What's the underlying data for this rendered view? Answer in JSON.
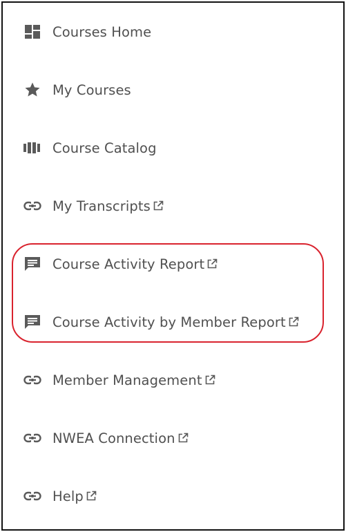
{
  "nav": {
    "items": [
      {
        "label": "Courses Home",
        "icon": "dashboard-icon",
        "external": false
      },
      {
        "label": "My Courses",
        "icon": "star-icon",
        "external": false
      },
      {
        "label": "Course Catalog",
        "icon": "catalog-icon",
        "external": false
      },
      {
        "label": "My Transcripts",
        "icon": "link-icon",
        "external": true
      },
      {
        "label": "Course Activity Report",
        "icon": "report-icon",
        "external": true
      },
      {
        "label": "Course Activity by Member Report",
        "icon": "report-icon",
        "external": true
      },
      {
        "label": "Member Management",
        "icon": "link-icon",
        "external": true
      },
      {
        "label": "NWEA Connection",
        "icon": "link-icon",
        "external": true
      },
      {
        "label": "Help",
        "icon": "link-icon",
        "external": true
      }
    ]
  },
  "colors": {
    "text": "#505050",
    "icon": "#5a5a5a",
    "highlight": "#d9222d",
    "border": "#111111"
  }
}
